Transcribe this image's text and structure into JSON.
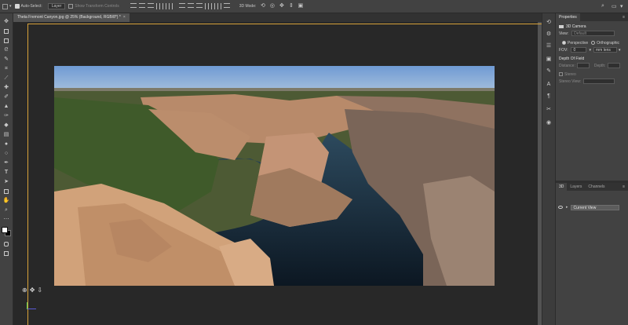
{
  "options_bar": {
    "auto_select_label": "Auto-Select:",
    "layer_select": "Layer",
    "show_transform_controls": "Show Transform Controls",
    "mode_3d_label": "3D Mode:"
  },
  "document": {
    "tab_title": "Theta Fremont Canyon.jpg @ 25% (Background, RGB/8*) *",
    "close_glyph": "×"
  },
  "tools": [
    "move",
    "artboard",
    "marquee",
    "lasso",
    "quick-select",
    "crop",
    "eyedropper",
    "healing",
    "brush",
    "stamp",
    "history-brush",
    "eraser",
    "gradient",
    "blur",
    "dodge",
    "pen",
    "type",
    "path-select",
    "shape",
    "hand",
    "zoom",
    "more"
  ],
  "properties": {
    "tab_label": "Properties",
    "panel_title": "3D Camera",
    "view_label": "View:",
    "view_value": "Default",
    "perspective_label": "Perspective",
    "orthographic_label": "Orthographic",
    "fov_label": "FOV:",
    "fov_value": "0",
    "lens_value": "mm lens",
    "dof_title": "Depth Of Field",
    "distance_label": "Distance:",
    "depth_label": "Depth:",
    "stereo_label": "Stereo",
    "stereo_view_label": "Stereo View:"
  },
  "layers": {
    "tabs": [
      "3D",
      "Layers",
      "Channels"
    ],
    "current_view_label": "Current View"
  },
  "colors": {
    "accent_border": "#d8a23a",
    "workspace": "#282828",
    "panel": "#424242"
  }
}
